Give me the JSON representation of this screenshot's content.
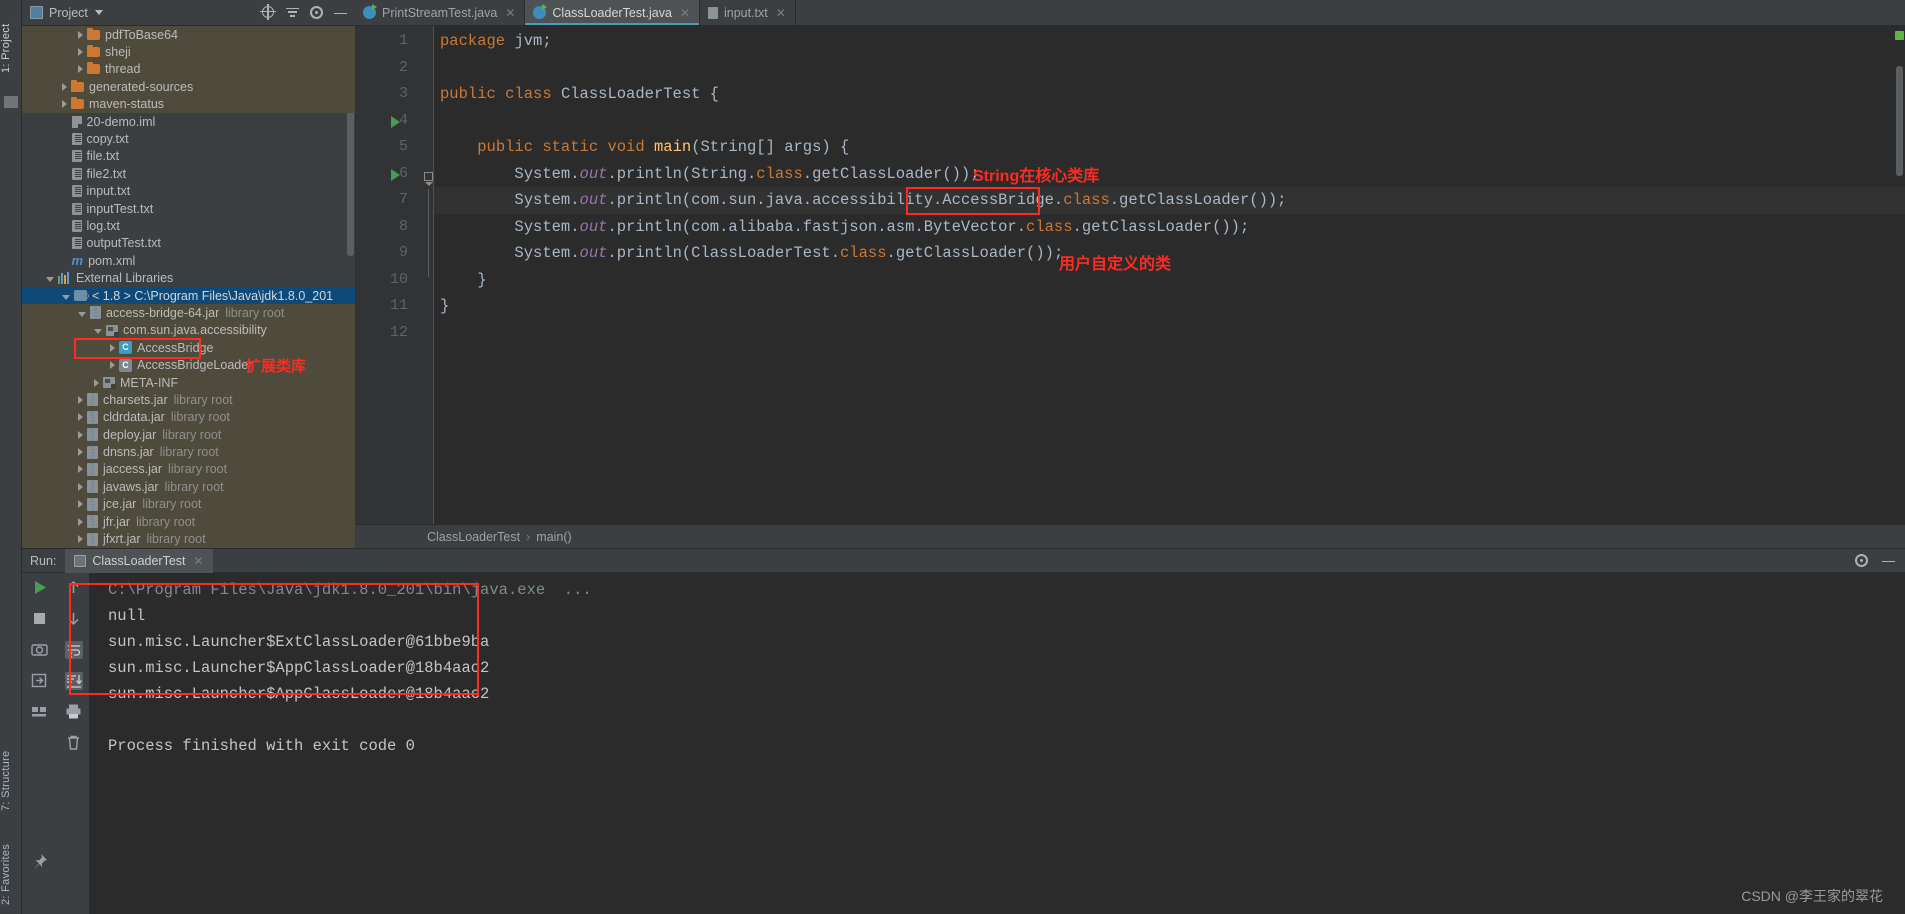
{
  "window": {
    "left_tabs": [
      "1: Project",
      "7: Structure",
      "2: Favorites"
    ]
  },
  "project_panel": {
    "title": "Project",
    "icons": [
      "locate-icon",
      "collapse-all-icon",
      "gear-icon",
      "minimize-icon"
    ],
    "tree": [
      {
        "depth": 3,
        "arrow": "closed",
        "icon": "folder-icon",
        "label": "pdfToBase64",
        "suffix": "",
        "state": "mod"
      },
      {
        "depth": 3,
        "arrow": "closed",
        "icon": "folder-icon",
        "label": "sheji",
        "suffix": "",
        "state": "mod"
      },
      {
        "depth": 3,
        "arrow": "closed",
        "icon": "folder-icon",
        "label": "thread",
        "suffix": "",
        "state": "mod"
      },
      {
        "depth": 2,
        "arrow": "closed",
        "icon": "folder-icon",
        "label": "generated-sources",
        "suffix": "",
        "state": "mod"
      },
      {
        "depth": 2,
        "arrow": "closed",
        "icon": "folder-icon",
        "label": "maven-status",
        "suffix": "",
        "state": "mod"
      },
      {
        "depth": 2,
        "arrow": "none",
        "icon": "iml-file-icon",
        "label": "20-demo.iml",
        "suffix": "",
        "state": ""
      },
      {
        "depth": 2,
        "arrow": "none",
        "icon": "text-file-icon",
        "label": "copy.txt",
        "suffix": "",
        "state": ""
      },
      {
        "depth": 2,
        "arrow": "none",
        "icon": "text-file-icon",
        "label": "file.txt",
        "suffix": "",
        "state": ""
      },
      {
        "depth": 2,
        "arrow": "none",
        "icon": "text-file-icon",
        "label": "file2.txt",
        "suffix": "",
        "state": ""
      },
      {
        "depth": 2,
        "arrow": "none",
        "icon": "text-file-icon",
        "label": "input.txt",
        "suffix": "",
        "state": ""
      },
      {
        "depth": 2,
        "arrow": "none",
        "icon": "text-file-icon",
        "label": "inputTest.txt",
        "suffix": "",
        "state": ""
      },
      {
        "depth": 2,
        "arrow": "none",
        "icon": "text-file-icon",
        "label": "log.txt",
        "suffix": "",
        "state": ""
      },
      {
        "depth": 2,
        "arrow": "none",
        "icon": "text-file-icon",
        "label": "outputTest.txt",
        "suffix": "",
        "state": ""
      },
      {
        "depth": 2,
        "arrow": "none",
        "icon": "maven-icon",
        "label": "pom.xml",
        "suffix": "",
        "state": ""
      },
      {
        "depth": 1,
        "arrow": "open",
        "icon": "libraries-icon",
        "label": "External Libraries",
        "suffix": "",
        "state": ""
      },
      {
        "depth": 2,
        "arrow": "open",
        "icon": "jdk-icon",
        "label": "< 1.8 >  C:\\Program Files\\Java\\jdk1.8.0_201",
        "suffix": "",
        "state": "sel"
      },
      {
        "depth": 3,
        "arrow": "open",
        "icon": "jar-icon",
        "label": "access-bridge-64.jar",
        "suffix": "library root",
        "state": "mod"
      },
      {
        "depth": 4,
        "arrow": "open",
        "icon": "package-icon",
        "label": "com.sun.java.accessibility",
        "suffix": "",
        "state": "mod"
      },
      {
        "depth": 5,
        "arrow": "closed",
        "icon": "class-icon",
        "label": "AccessBridge",
        "suffix": "",
        "state": "mod"
      },
      {
        "depth": 5,
        "arrow": "closed",
        "icon": "class-dim-icon",
        "label": "AccessBridgeLoader",
        "suffix": "",
        "state": "mod"
      },
      {
        "depth": 4,
        "arrow": "closed",
        "icon": "package-icon",
        "label": "META-INF",
        "suffix": "",
        "state": "mod"
      },
      {
        "depth": 3,
        "arrow": "closed",
        "icon": "jar-icon",
        "label": "charsets.jar",
        "suffix": "library root",
        "state": "mod"
      },
      {
        "depth": 3,
        "arrow": "closed",
        "icon": "jar-icon",
        "label": "cldrdata.jar",
        "suffix": "library root",
        "state": "mod"
      },
      {
        "depth": 3,
        "arrow": "closed",
        "icon": "jar-icon",
        "label": "deploy.jar",
        "suffix": "library root",
        "state": "mod"
      },
      {
        "depth": 3,
        "arrow": "closed",
        "icon": "jar-icon",
        "label": "dnsns.jar",
        "suffix": "library root",
        "state": "mod"
      },
      {
        "depth": 3,
        "arrow": "closed",
        "icon": "jar-icon",
        "label": "jaccess.jar",
        "suffix": "library root",
        "state": "mod"
      },
      {
        "depth": 3,
        "arrow": "closed",
        "icon": "jar-icon",
        "label": "javaws.jar",
        "suffix": "library root",
        "state": "mod"
      },
      {
        "depth": 3,
        "arrow": "closed",
        "icon": "jar-icon",
        "label": "jce.jar",
        "suffix": "library root",
        "state": "mod"
      },
      {
        "depth": 3,
        "arrow": "closed",
        "icon": "jar-icon",
        "label": "jfr.jar",
        "suffix": "library root",
        "state": "mod"
      },
      {
        "depth": 3,
        "arrow": "closed",
        "icon": "jar-icon",
        "label": "jfxrt.jar",
        "suffix": "library root",
        "state": "mod"
      }
    ]
  },
  "editor": {
    "tabs": [
      {
        "label": "PrintStreamTest.java",
        "icon": "java-class-icon",
        "active": false,
        "closable": true
      },
      {
        "label": "ClassLoaderTest.java",
        "icon": "java-class-icon",
        "active": true,
        "closable": true
      },
      {
        "label": "input.txt",
        "icon": "text-file-icon",
        "active": false,
        "closable": true
      }
    ],
    "line_numbers": [
      "1",
      "2",
      "3",
      "4",
      "5",
      "6",
      "7",
      "8",
      "9",
      "10",
      "11",
      "12"
    ],
    "lines": [
      "package jvm;",
      "",
      "public class ClassLoaderTest {",
      "",
      "    public static void main(String[] args) {",
      "        System.out.println(String.class.getClassLoader());",
      "        System.out.println(com.sun.java.accessibility.AccessBridge.class.getClassLoader());",
      "        System.out.println(com.alibaba.fastjson.asm.ByteVector.class.getClassLoader());",
      "        System.out.println(ClassLoaderTest.class.getClassLoader());",
      "    }",
      "}",
      ""
    ],
    "breadcrumb": [
      "ClassLoaderTest",
      "main()"
    ],
    "breadcrumb_separator": "›"
  },
  "annotations": {
    "core_library": "String在核心类库",
    "user_class": "用户自定义的类",
    "extension_library": "扩展类库",
    "color": "#ff2a20"
  },
  "run_panel": {
    "label": "Run:",
    "tab_label": "ClassLoaderTest",
    "toolbar_icons": [
      "rerun-icon",
      "stop-icon",
      "screenshot-icon",
      "export-icon",
      "layout-icon",
      "up-arrow-icon",
      "down-arrow-icon",
      "soft-wrap-icon",
      "scroll-to-end-icon",
      "print-icon",
      "clear-all-icon",
      "pin-icon"
    ],
    "header_icons": [
      "settings-icon",
      "hide-icon"
    ],
    "command_line": "C:\\Program Files\\Java\\jdk1.8.0_201\\bin\\java.exe  ...",
    "output": [
      "null",
      "sun.misc.Launcher$ExtClassLoader@61bbe9ba",
      "sun.misc.Launcher$AppClassLoader@18b4aac2",
      "sun.misc.Launcher$AppClassLoader@18b4aac2"
    ],
    "exit_message": "Process finished with exit code 0"
  },
  "watermark": "CSDN @李王家的翠花"
}
